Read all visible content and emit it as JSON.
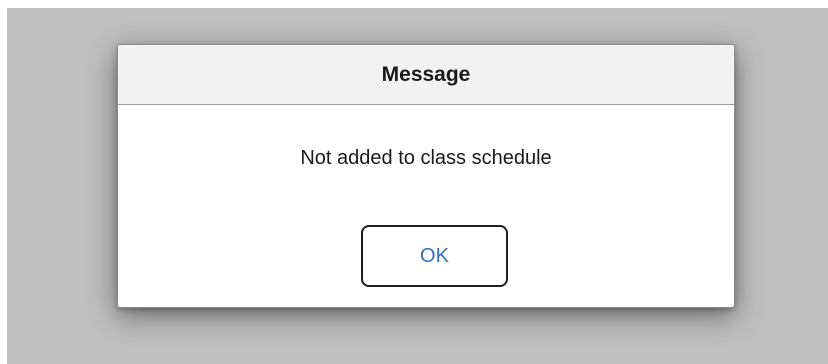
{
  "dialog": {
    "title": "Message",
    "message": "Not added to class schedule",
    "ok_label": "OK"
  },
  "colors": {
    "overlay": "#bfbfbf",
    "header_bg": "#f2f2f2",
    "button_text": "#2f6fc4"
  }
}
